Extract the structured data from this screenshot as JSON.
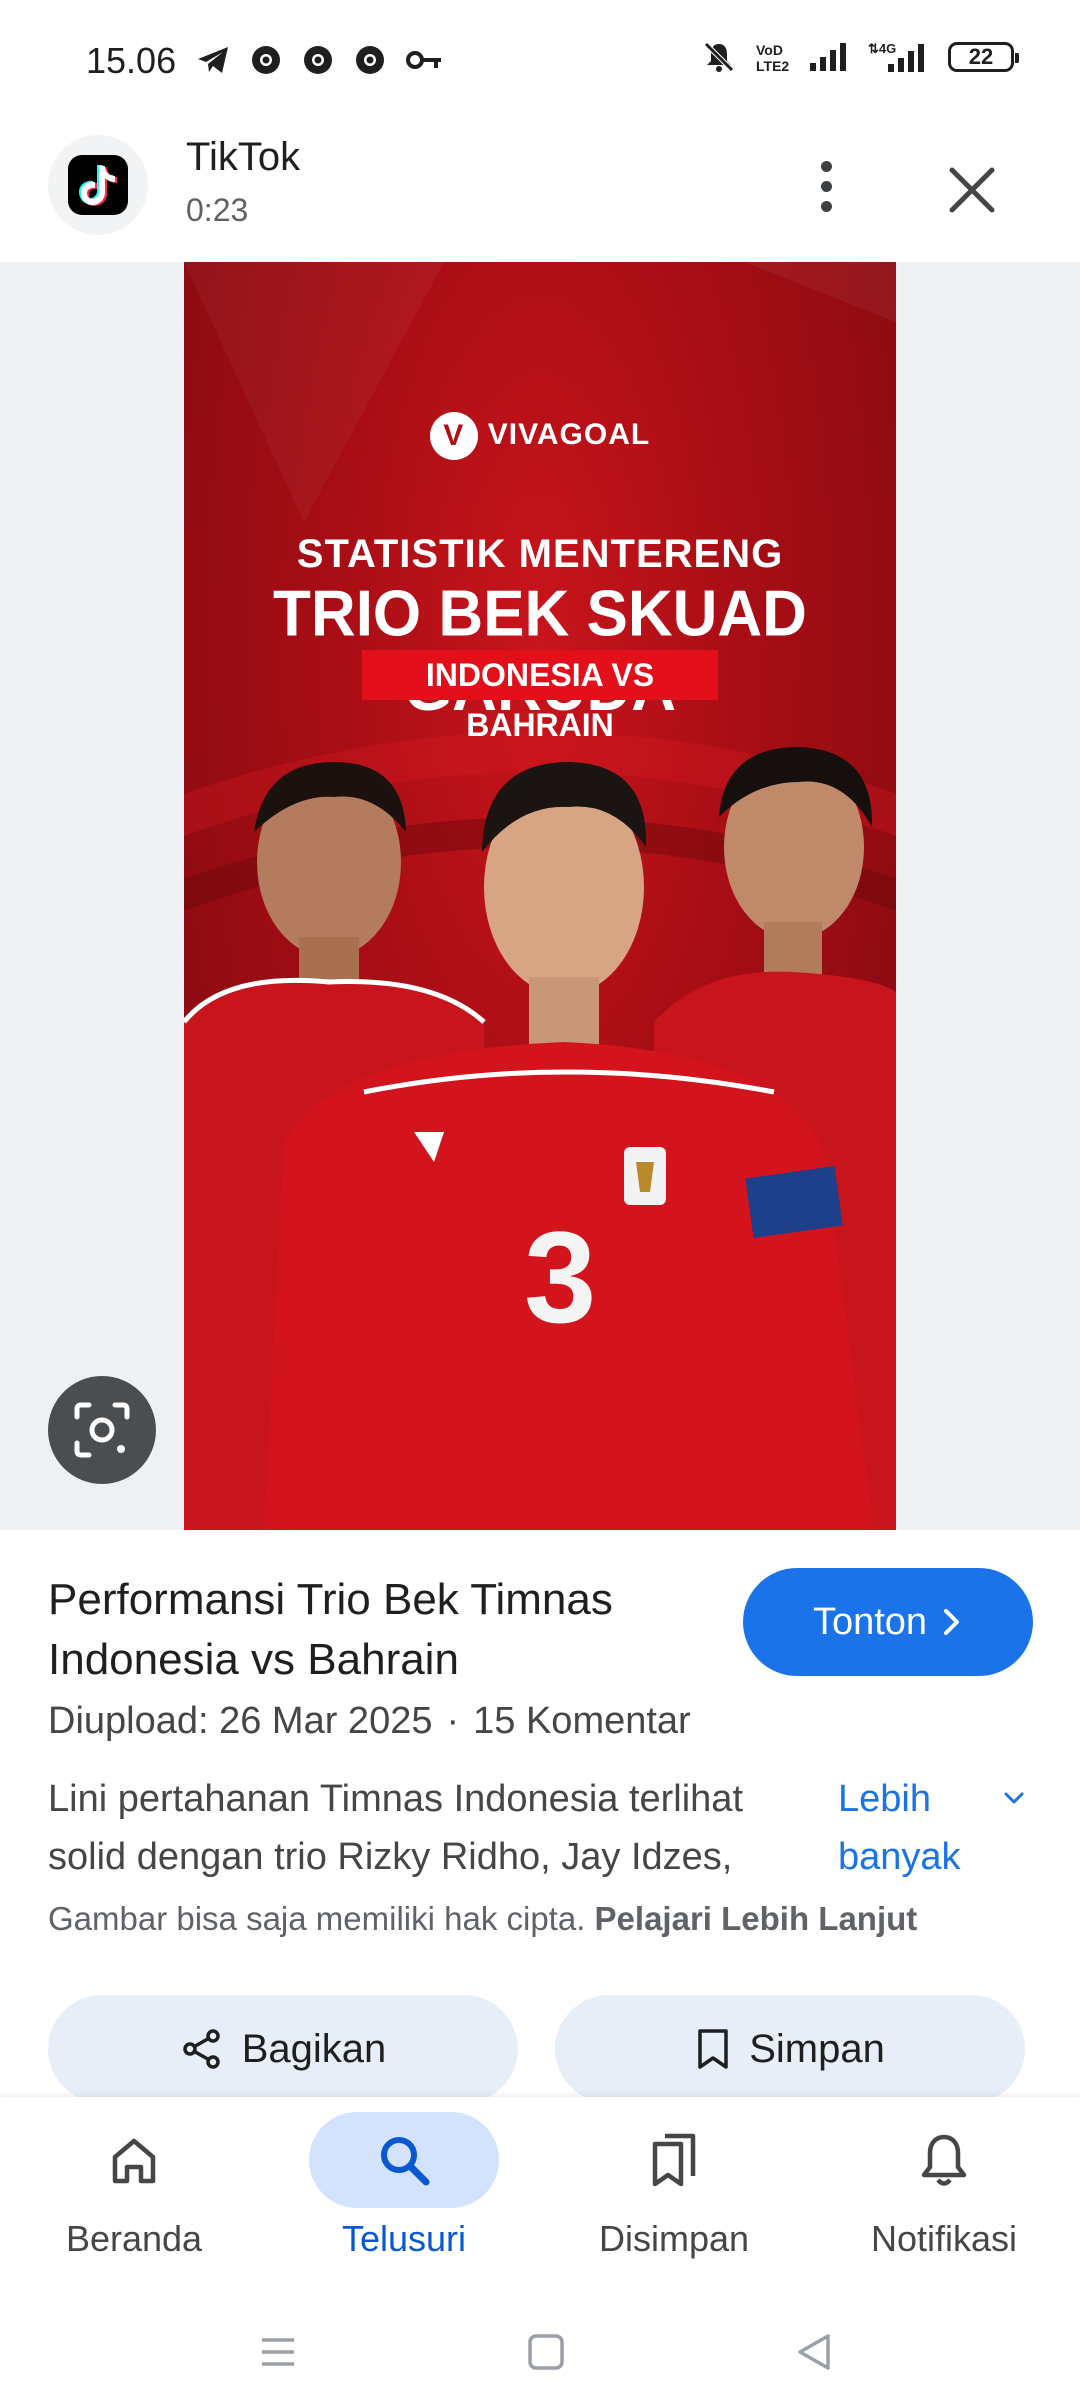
{
  "status_bar": {
    "time": "15.06",
    "battery": "22",
    "left_icons": [
      "telegram-icon",
      "chrome-icon",
      "chrome-icon",
      "chrome-icon",
      "vpn-key-icon"
    ],
    "right_icons": [
      "mute-icon",
      "volte-icon",
      "signal-icon",
      "signal-4g-icon",
      "battery-icon"
    ]
  },
  "header": {
    "app_name": "TikTok",
    "duration": "0:23"
  },
  "thumbnail": {
    "brand": "VIVAGOAL",
    "line1": "STATISTIK MENTERENG",
    "line2": "TRIO BEK SKUAD GARUDA",
    "line3": "INDONESIA VS BAHRAIN"
  },
  "info": {
    "title": "Performansi Trio Bek Timnas Indonesia vs Bahrain",
    "watch_label": "Tonton",
    "uploaded": "Diupload: 26 Mar 2025",
    "separator": "·",
    "comments": "15 Komentar",
    "desc_line1": "Lini pertahanan Timnas Indonesia terlihat",
    "desc_line2": "solid dengan trio Rizky Ridho, Jay Idzes,",
    "more_label": "Lebih banyak",
    "copyright_text": "Gambar bisa saja memiliki hak cipta.",
    "copyright_link": "Pelajari Lebih Lanjut"
  },
  "actions": {
    "share_label": "Bagikan",
    "save_label": "Simpan"
  },
  "bottom_nav": {
    "items": [
      {
        "label": "Beranda",
        "icon": "home-icon"
      },
      {
        "label": "Telusuri",
        "icon": "search-icon",
        "active": true
      },
      {
        "label": "Disimpan",
        "icon": "bookmarks-icon"
      },
      {
        "label": "Notifikasi",
        "icon": "bell-icon"
      }
    ]
  },
  "colors": {
    "accent": "#1a73e8",
    "active_nav_bg": "#d3e3fd",
    "action_bg": "#e8eef8",
    "thumb_red": "#b10f16"
  }
}
